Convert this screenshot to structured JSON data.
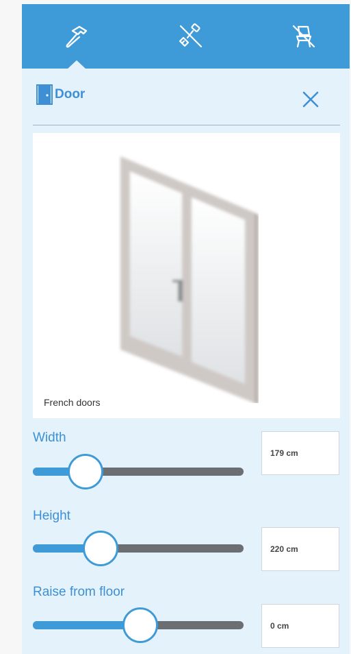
{
  "toolbar": {
    "tools": [
      {
        "icon": "hammer-icon",
        "active": true
      },
      {
        "icon": "paint-roller-icon",
        "active": false
      },
      {
        "icon": "chair-icon",
        "active": false
      }
    ],
    "color": "#3e9bd8"
  },
  "header": {
    "icon": "door-icon",
    "title": "Door",
    "close_icon": "close-icon"
  },
  "preview": {
    "caption": "French doors"
  },
  "sliders": [
    {
      "label": "Width",
      "value": "179 cm",
      "level": 0.25
    },
    {
      "label": "Height",
      "value": "220 cm",
      "level": 0.32
    },
    {
      "label": "Raise from floor",
      "value": "0 cm",
      "level": 0.51
    }
  ],
  "colors": {
    "accent": "#3e9bd8",
    "panel_bg": "#e3f2fb",
    "track": "#6b6f72"
  }
}
